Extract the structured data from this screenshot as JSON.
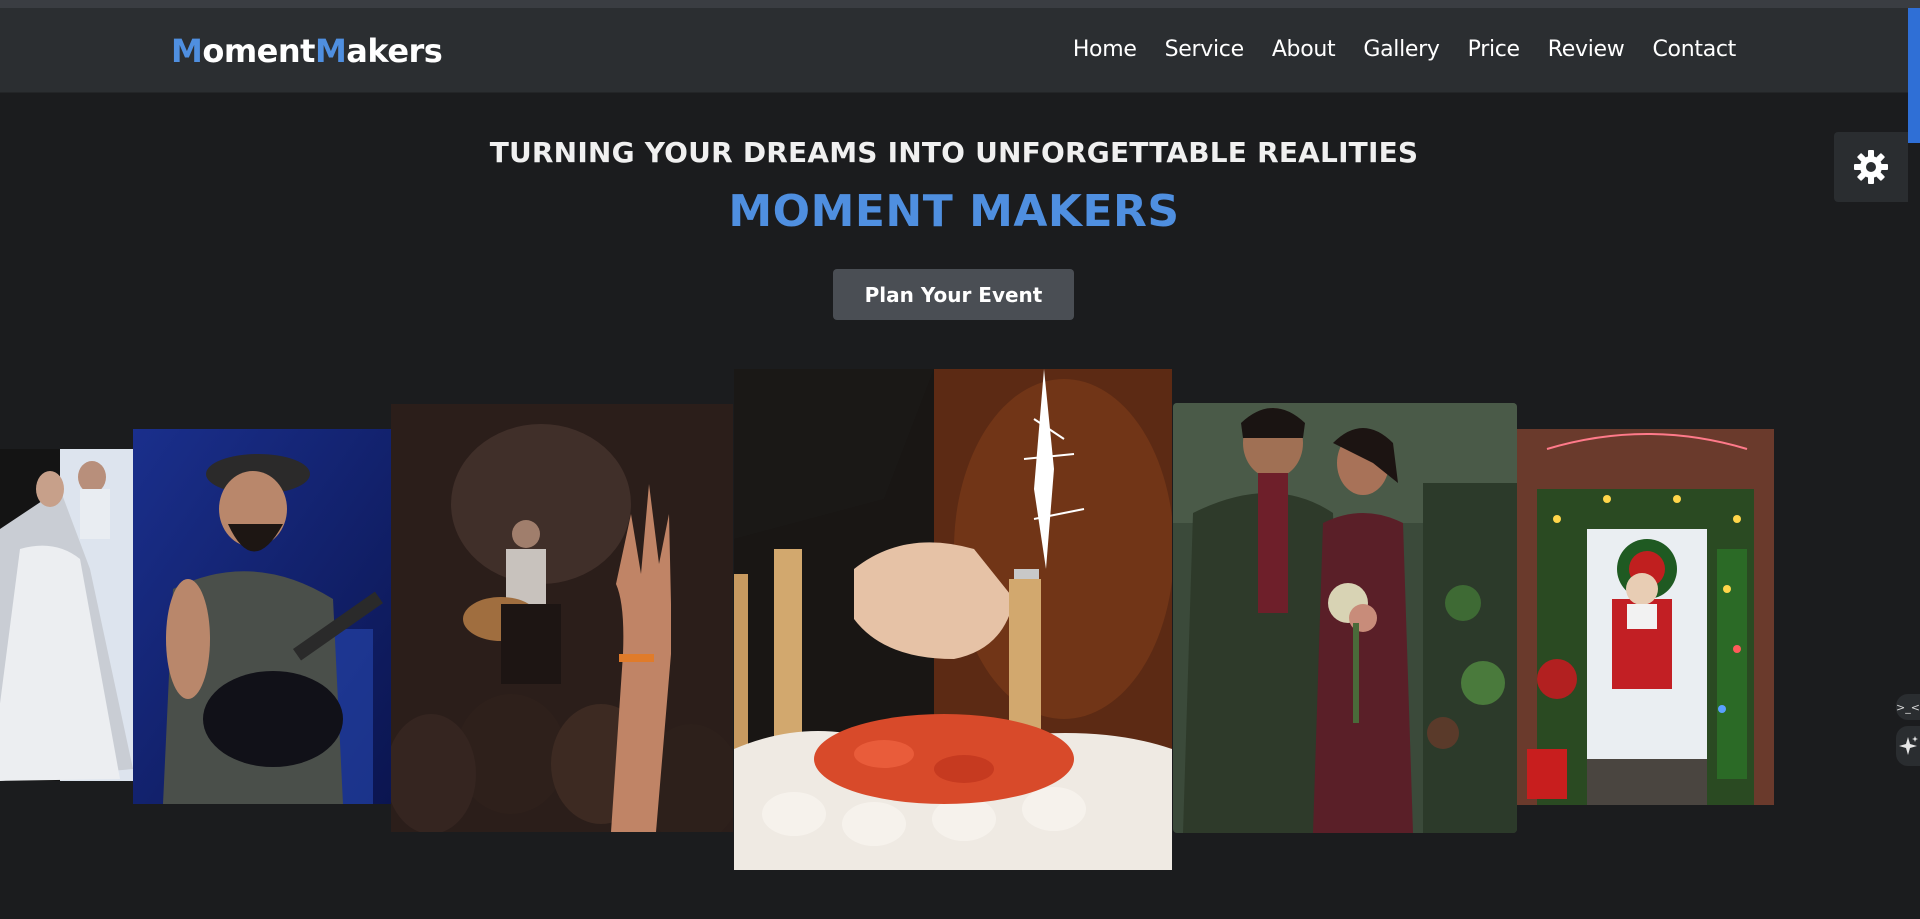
{
  "brand": {
    "part1_initial": "M",
    "part1_rest": "oment",
    "part2_initial": "M",
    "part2_rest": "akers",
    "accent": "#4f8fe0"
  },
  "nav": {
    "items": [
      "Home",
      "Service",
      "About",
      "Gallery",
      "Price",
      "Review",
      "Contact"
    ]
  },
  "hero": {
    "subtitle": "TURNING YOUR DREAMS INTO UNFORGETTABLE REALITIES",
    "title": "MOMENT MAKERS",
    "cta_label": "Plan Your Event"
  },
  "gallery": {
    "images": [
      {
        "name": "bride-and-groom-photo"
      },
      {
        "name": "guitarist-performing-photo"
      },
      {
        "name": "concert-crowd-photo"
      },
      {
        "name": "birthday-cake-sparkler-photo"
      },
      {
        "name": "engaged-couple-photo"
      },
      {
        "name": "christmas-decorated-door-photo"
      }
    ]
  },
  "widgets": {
    "settings_icon": "gear-icon",
    "sparkle_icon": "sparkle-icon",
    "code_icon": "code-icon"
  },
  "colors": {
    "background": "#1b1c1e",
    "navbar": "#2b2e31",
    "accent": "#4f8fe0",
    "button": "#4a4e54"
  }
}
